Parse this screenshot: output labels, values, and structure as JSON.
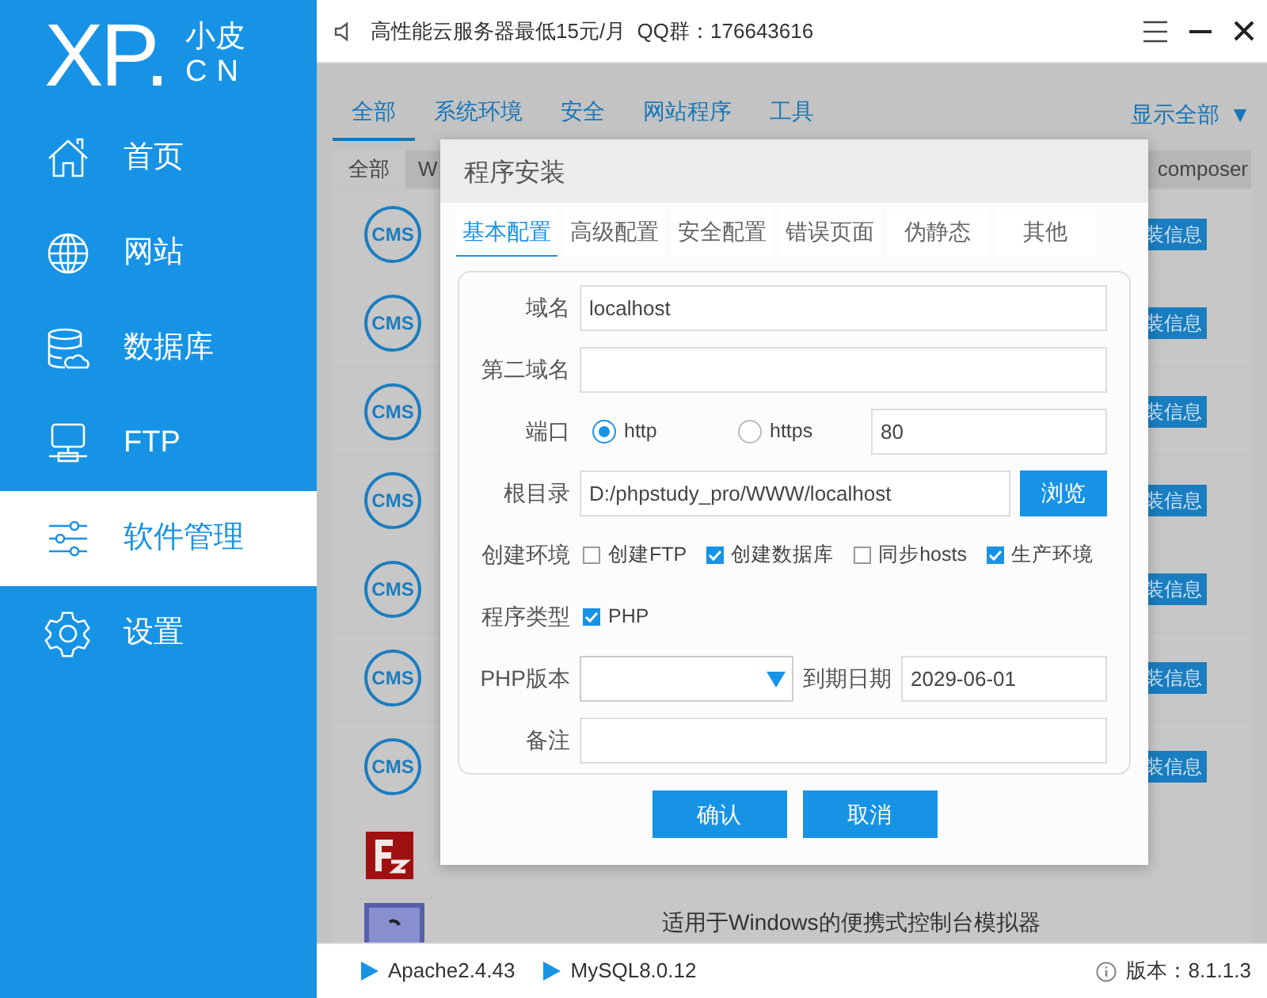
{
  "sidebar": {
    "logo": {
      "main": "XP.",
      "top": "小皮",
      "bottom": "CN"
    },
    "items": [
      {
        "label": "首页",
        "kind": "home",
        "selected": false
      },
      {
        "label": "网站",
        "kind": "globe",
        "selected": false
      },
      {
        "label": "数据库",
        "kind": "database",
        "selected": false
      },
      {
        "label": "FTP",
        "kind": "ftp",
        "selected": false
      },
      {
        "label": "软件管理",
        "kind": "sliders",
        "selected": true
      },
      {
        "label": "设置",
        "kind": "gear",
        "selected": false
      }
    ]
  },
  "top_bar": {
    "notice": "高性能云服务器最低15元/月  QQ群：176643616"
  },
  "category_tabs": [
    {
      "label": "全部",
      "selected": true
    },
    {
      "label": "系统环境",
      "selected": false
    },
    {
      "label": "安全",
      "selected": false
    },
    {
      "label": "网站程序",
      "selected": false
    },
    {
      "label": "工具",
      "selected": false
    }
  ],
  "show_all": {
    "label": "显示全部",
    "arrow": "▼"
  },
  "sub_tabs": [
    {
      "label": "全部",
      "selected": true
    },
    {
      "label": "W",
      "selected": false
    },
    {
      "label": "composer",
      "selected": false
    }
  ],
  "software_rows": [
    {
      "kind": "cms",
      "icon_text": "CMS",
      "button": "装信息"
    },
    {
      "kind": "cms",
      "icon_text": "CMS",
      "button": "装信息"
    },
    {
      "kind": "cms",
      "icon_text": "CMS",
      "button": "装信息"
    },
    {
      "kind": "cms",
      "icon_text": "CMS",
      "button": "装信息"
    },
    {
      "kind": "cms",
      "icon_text": "CMS",
      "button": "装信息"
    },
    {
      "kind": "cms",
      "icon_text": "CMS",
      "button": "装信息"
    },
    {
      "kind": "cms",
      "icon_text": "CMS",
      "button": "装信息"
    },
    {
      "kind": "filezilla"
    },
    {
      "kind": "console",
      "description": "适用于Windows的便携式控制台模拟器"
    }
  ],
  "dialog": {
    "title": "程序安装",
    "tabs": [
      {
        "label": "基本配置",
        "selected": true
      },
      {
        "label": "高级配置",
        "selected": false
      },
      {
        "label": "安全配置",
        "selected": false
      },
      {
        "label": "错误页面",
        "selected": false
      },
      {
        "label": "伪静态",
        "selected": false
      },
      {
        "label": "其他",
        "selected": false
      }
    ],
    "domain": {
      "label": "域名",
      "value": "localhost"
    },
    "second_domain": {
      "label": "第二域名"
    },
    "port": {
      "label": "端口",
      "options": [
        {
          "label": "http",
          "selected": true
        },
        {
          "label": "https",
          "selected": false
        }
      ],
      "value": "80"
    },
    "root": {
      "label": "根目录",
      "value": "D:/phpstudy_pro/WWW/localhost",
      "button": "浏览"
    },
    "environment": {
      "label": "创建环境",
      "options": [
        {
          "label": "创建FTP",
          "checked": false
        },
        {
          "label": "创建数据库",
          "checked": true
        },
        {
          "label": "同步hosts",
          "checked": false
        },
        {
          "label": "生产环境",
          "checked": true
        }
      ]
    },
    "program_type": {
      "label": "程序类型",
      "options": [
        {
          "label": "PHP",
          "checked": true
        }
      ]
    },
    "php_version": {
      "label": "PHP版本"
    },
    "expire": {
      "label": "到期日期",
      "value": "2029-06-01"
    },
    "remark": {
      "label": "备注"
    },
    "buttons": [
      "确认",
      "取消"
    ]
  },
  "status_bar": {
    "services": [
      {
        "name": "Apache2.4.43"
      },
      {
        "name": "MySQL8.0.12"
      }
    ],
    "version": "版本：8.1.1.3"
  }
}
